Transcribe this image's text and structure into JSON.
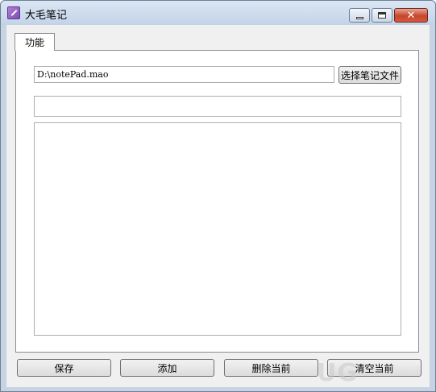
{
  "window": {
    "title": "大毛笔记",
    "icons": {
      "app": "note-pen-icon",
      "minimize": "minimize-icon",
      "maximize": "maximize-icon",
      "close": "close-icon"
    }
  },
  "tabs": [
    {
      "label": "功能",
      "selected": true
    }
  ],
  "file": {
    "path_value": "D:\\notePad.mao",
    "choose_label": "选择笔记文件"
  },
  "note": {
    "title_value": "",
    "content_value": ""
  },
  "actions": {
    "save_label": "保存",
    "add_label": "添加",
    "delete_label": "删除当前",
    "clear_label": "清空当前"
  },
  "watermark": "UG",
  "colors": {
    "titlebar": "#c6d3e3",
    "close_button": "#c8442c",
    "client_bg": "#f0f0f0"
  }
}
